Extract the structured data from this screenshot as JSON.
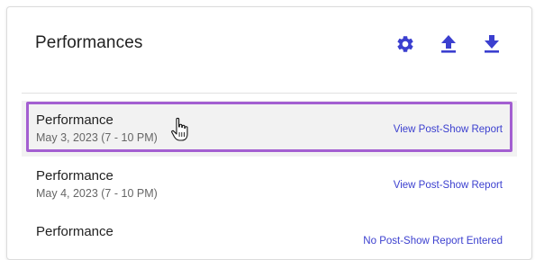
{
  "panel": {
    "title": "Performances"
  },
  "toolbar": {
    "settings_icon": "gear-icon",
    "upload_icon": "upload-icon",
    "download_icon": "download-icon",
    "accent_color": "#3b3fcf"
  },
  "performances": [
    {
      "title": "Performance",
      "date": "May 3, 2023 (7 - 10 PM)",
      "action": "View Post-Show Report",
      "selected": true
    },
    {
      "title": "Performance",
      "date": "May 4, 2023 (7 - 10 PM)",
      "action": "View Post-Show Report",
      "selected": false
    },
    {
      "title": "Performance",
      "date": "",
      "action": "No Post-Show Report Entered",
      "selected": false
    }
  ],
  "highlight_color": "#a35fd1"
}
